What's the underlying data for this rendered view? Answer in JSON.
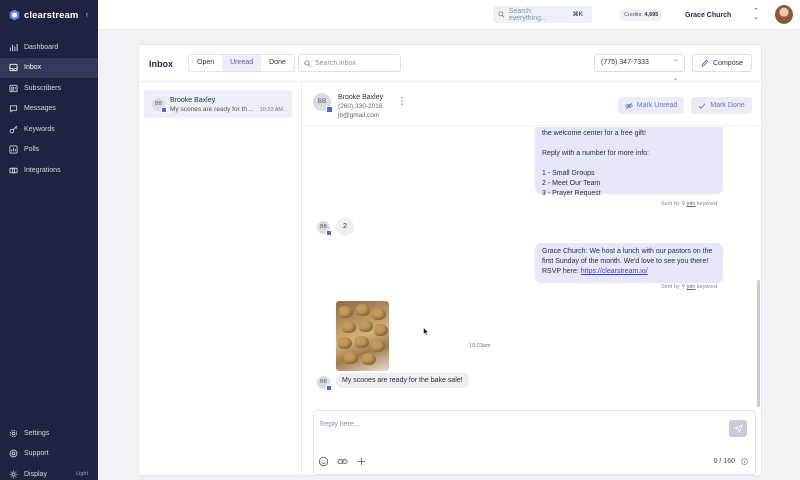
{
  "brand": {
    "name": "clearstream"
  },
  "nav": {
    "items": [
      {
        "id": "dashboard",
        "label": "Dashboard"
      },
      {
        "id": "inbox",
        "label": "Inbox"
      },
      {
        "id": "subscribers",
        "label": "Subscribers"
      },
      {
        "id": "messages",
        "label": "Messages"
      },
      {
        "id": "keywords",
        "label": "Keywords"
      },
      {
        "id": "polls",
        "label": "Polls"
      },
      {
        "id": "integrations",
        "label": "Integrations"
      }
    ],
    "active": "inbox",
    "bottom": [
      {
        "id": "settings",
        "label": "Settings"
      },
      {
        "id": "support",
        "label": "Support"
      },
      {
        "id": "display",
        "label": "Display",
        "mode": "Light"
      }
    ]
  },
  "topbar": {
    "search_placeholder": "Search everything...",
    "search_shortcut": "⌘K",
    "credits_label": "Credits:",
    "credits_value": "4,695",
    "org_name": "Grace Church"
  },
  "inbox": {
    "title": "Inbox",
    "tabs": [
      "Open",
      "Unread",
      "Done"
    ],
    "active_tab": "Unread",
    "search_placeholder": "Search inbox",
    "phone_number": "(775) 347-7333",
    "compose_label": "Compose",
    "conversations": [
      {
        "initials": "BB",
        "name": "Brooke Baxley",
        "preview": "My scones are ready for the bake sale!",
        "time": "10:23 AM"
      }
    ]
  },
  "thread": {
    "contact": {
      "initials": "BB",
      "name": "Brooke Baxley",
      "phone": "(260) 330-2016",
      "email": "jb@gmail.com"
    },
    "mark_unread_label": "Mark Unread",
    "mark_done_label": "Mark Done",
    "msg1_text": "the welcome center for a free gift!\n\nReply with a number for more info:\n\n1 - Small Groups\n2 - Meet Our Team\n3 - Prayer Request",
    "msg1_sent_by": "Sent by",
    "msg1_keyword": "join",
    "msg1_keyword_suffix": "keyword",
    "msg2_text": "2",
    "msg3_text": "Grace Church: We host a lunch with our pastors on the first Sunday of the month. We'd love to see you there!\nRSVP here: ",
    "msg3_link": "https://clearstream.io/",
    "msg3_sent_by": "Sent by",
    "msg3_keyword": "join",
    "msg3_keyword_suffix": "keyword",
    "msg4_time": "10:23am",
    "msg5_text": "My scones are ready for the bake sale!",
    "reply_placeholder": "Reply here...",
    "char_count": "0 / 160"
  }
}
